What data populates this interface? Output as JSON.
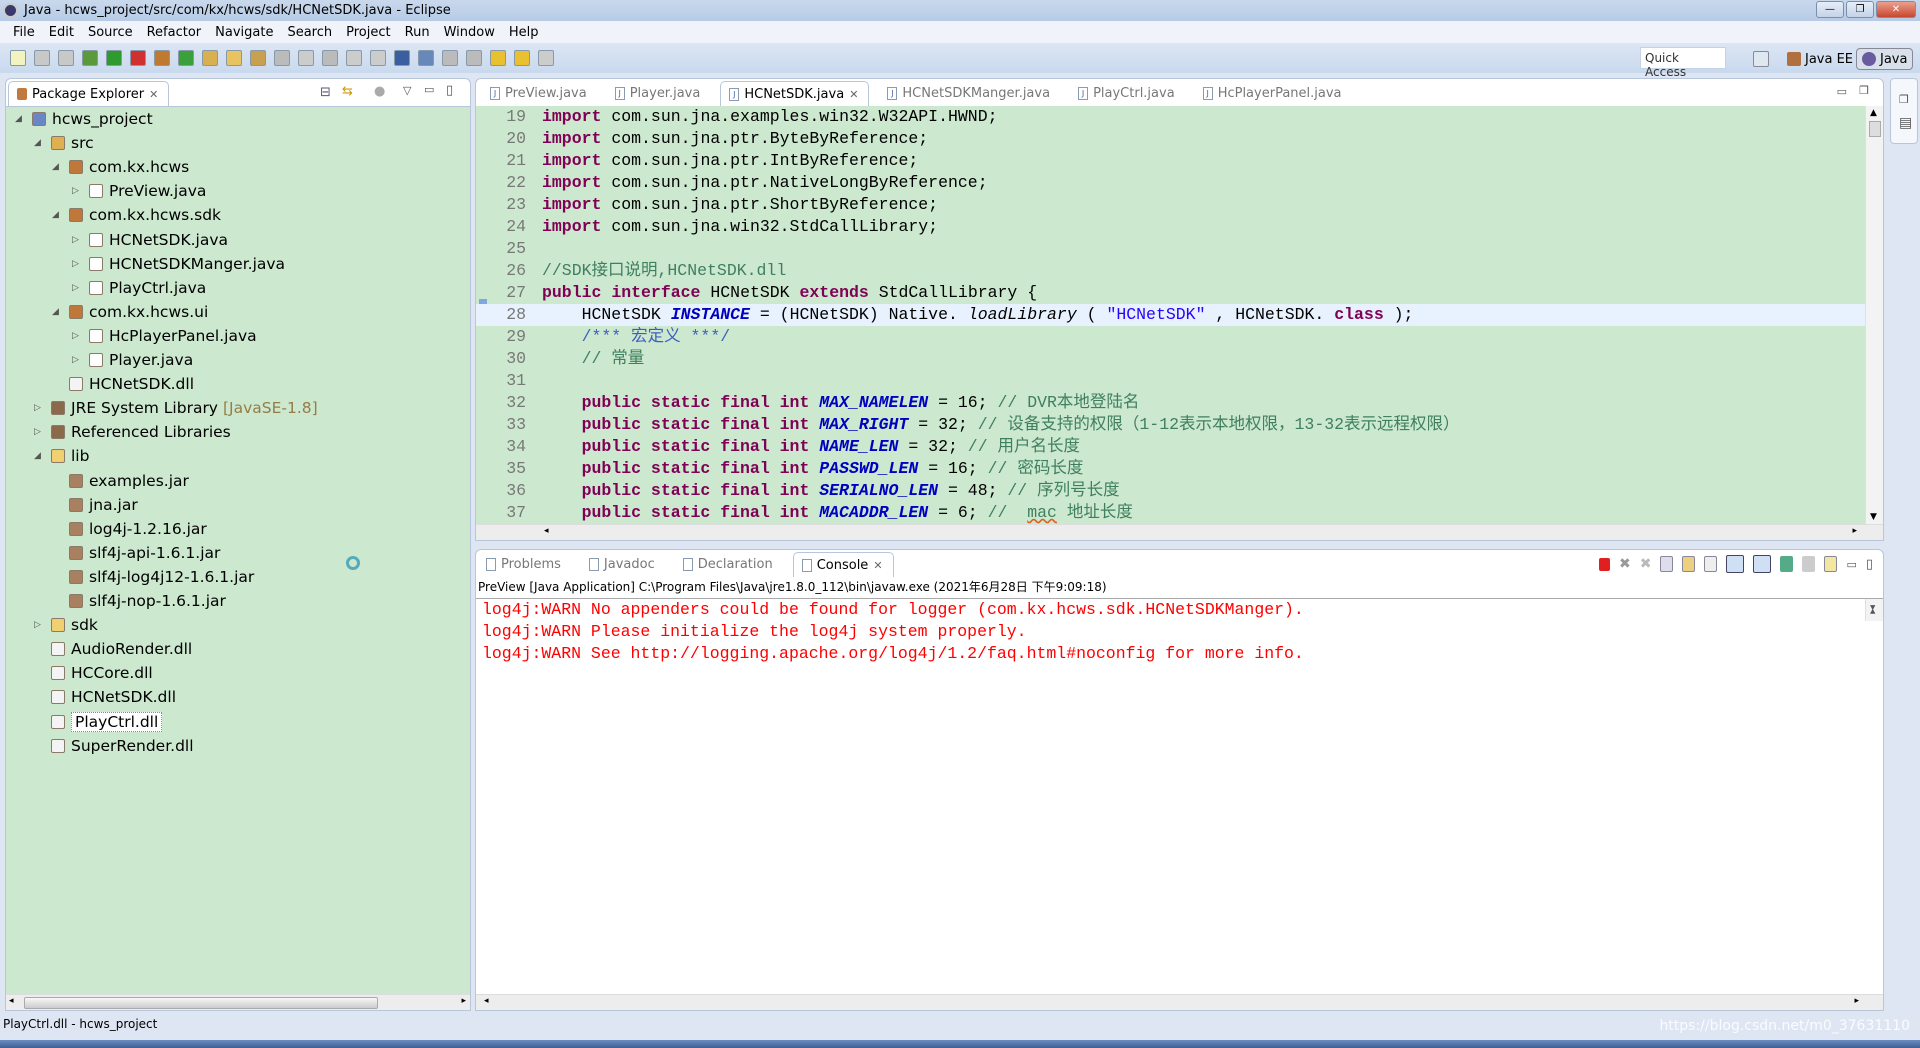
{
  "window": {
    "title": "Java - hcws_project/src/com/kx/hcws/sdk/HCNetSDK.java - Eclipse",
    "controls": [
      "—",
      "❐",
      "✕"
    ]
  },
  "menu": [
    "File",
    "Edit",
    "Source",
    "Refactor",
    "Navigate",
    "Search",
    "Project",
    "Run",
    "Window",
    "Help"
  ],
  "toolbar": {
    "icons": [
      {
        "name": "new-icon",
        "color": "#f3f3c0"
      },
      {
        "name": "save-icon",
        "color": "#c8c8c8"
      },
      {
        "name": "save-all-icon",
        "color": "#c8c8c8"
      },
      {
        "name": "debug-icon",
        "color": "#5a9a3a"
      },
      {
        "name": "run-icon",
        "color": "#2e9b2e"
      },
      {
        "name": "run-external-icon",
        "color": "#d03030"
      },
      {
        "name": "new-package-icon",
        "color": "#c07a30"
      },
      {
        "name": "new-class-icon",
        "color": "#3aa03a"
      },
      {
        "name": "open-type-icon",
        "color": "#d9b050"
      },
      {
        "name": "open-folder-icon",
        "color": "#e8c460"
      },
      {
        "name": "search-icon",
        "color": "#c8a050"
      },
      {
        "name": "pin-icon",
        "color": "#bbbbbb"
      },
      {
        "name": "pen-icon",
        "color": "#cccccc"
      },
      {
        "name": "toggle-icon",
        "color": "#bbbbbb"
      },
      {
        "name": "block-icon",
        "color": "#cccccc"
      },
      {
        "name": "pilcrow-icon",
        "color": "#cccccc"
      },
      {
        "name": "monitor-icon",
        "color": "#3a5fa0"
      },
      {
        "name": "breakpoint-icon",
        "color": "#6688bb"
      },
      {
        "name": "next-annotation-icon",
        "color": "#bbbbbb"
      },
      {
        "name": "prev-annotation-icon",
        "color": "#bbbbbb"
      },
      {
        "name": "last-edit-icon",
        "color": "#e8c030"
      },
      {
        "name": "back-icon",
        "color": "#e8c030"
      },
      {
        "name": "forward-icon",
        "color": "#cccccc"
      }
    ],
    "quick_access": "Quick Access",
    "perspectives": [
      "Java EE",
      "Java"
    ]
  },
  "package_explorer": {
    "title": "Package Explorer",
    "items": [
      {
        "label": "hcws_project",
        "level": 0,
        "expander": "open",
        "icon": "project-icon",
        "color": "#6b86c7"
      },
      {
        "label": "src",
        "level": 1,
        "expander": "open",
        "icon": "source-folder-icon",
        "color": "#e0b050"
      },
      {
        "label": "com.kx.hcws",
        "level": 2,
        "expander": "open",
        "icon": "package-icon",
        "color": "#c0783a"
      },
      {
        "label": "PreView.java",
        "level": 3,
        "expander": "closed",
        "icon": "java-file-icon",
        "color": "#ffffff"
      },
      {
        "label": "com.kx.hcws.sdk",
        "level": 2,
        "expander": "open",
        "icon": "package-icon",
        "color": "#c0783a"
      },
      {
        "label": "HCNetSDK.java",
        "level": 3,
        "expander": "closed",
        "icon": "java-interface-file-icon",
        "color": "#ffffff"
      },
      {
        "label": "HCNetSDKManger.java",
        "level": 3,
        "expander": "closed",
        "icon": "java-file-icon",
        "color": "#ffffff"
      },
      {
        "label": "PlayCtrl.java",
        "level": 3,
        "expander": "closed",
        "icon": "java-interface-file-icon",
        "color": "#ffffff"
      },
      {
        "label": "com.kx.hcws.ui",
        "level": 2,
        "expander": "open",
        "icon": "package-icon",
        "color": "#c0783a"
      },
      {
        "label": "HcPlayerPanel.java",
        "level": 3,
        "expander": "closed",
        "icon": "java-file-icon",
        "color": "#ffffff"
      },
      {
        "label": "Player.java",
        "level": 3,
        "expander": "closed",
        "icon": "java-file-icon",
        "color": "#ffffff"
      },
      {
        "label": "HCNetSDK.dll",
        "level": 2,
        "expander": "none",
        "icon": "file-icon",
        "color": "#f4f4f4"
      },
      {
        "label": "JRE System Library",
        "suffix": "[JavaSE-1.8]",
        "level": 1,
        "expander": "closed",
        "icon": "library-icon",
        "color": "#8a6a4a"
      },
      {
        "label": "Referenced Libraries",
        "level": 1,
        "expander": "closed",
        "icon": "library-icon",
        "color": "#8a6a4a"
      },
      {
        "label": "lib",
        "level": 1,
        "expander": "open",
        "icon": "folder-icon",
        "color": "#f0d070"
      },
      {
        "label": "examples.jar",
        "level": 2,
        "expander": "none",
        "icon": "jar-icon",
        "color": "#a88060"
      },
      {
        "label": "jna.jar",
        "level": 2,
        "expander": "none",
        "icon": "jar-icon",
        "color": "#a88060"
      },
      {
        "label": "log4j-1.2.16.jar",
        "level": 2,
        "expander": "none",
        "icon": "jar-icon",
        "color": "#a88060"
      },
      {
        "label": "slf4j-api-1.6.1.jar",
        "level": 2,
        "expander": "none",
        "icon": "jar-icon",
        "color": "#a88060"
      },
      {
        "label": "slf4j-log4j12-1.6.1.jar",
        "level": 2,
        "expander": "none",
        "icon": "jar-icon",
        "color": "#a88060"
      },
      {
        "label": "slf4j-nop-1.6.1.jar",
        "level": 2,
        "expander": "none",
        "icon": "jar-icon",
        "color": "#a88060"
      },
      {
        "label": "sdk",
        "level": 1,
        "expander": "closed",
        "icon": "folder-icon",
        "color": "#f0d070"
      },
      {
        "label": "AudioRender.dll",
        "level": 1,
        "expander": "none",
        "icon": "file-icon",
        "color": "#f4f4f4"
      },
      {
        "label": "HCCore.dll",
        "level": 1,
        "expander": "none",
        "icon": "file-icon",
        "color": "#f4f4f4"
      },
      {
        "label": "HCNetSDK.dll",
        "level": 1,
        "expander": "none",
        "icon": "file-icon",
        "color": "#f4f4f4"
      },
      {
        "label": "PlayCtrl.dll",
        "level": 1,
        "expander": "none",
        "icon": "file-icon",
        "color": "#f4f4f4",
        "selected": true
      },
      {
        "label": "SuperRender.dll",
        "level": 1,
        "expander": "none",
        "icon": "file-icon",
        "color": "#f4f4f4"
      }
    ]
  },
  "editor": {
    "tabs": [
      {
        "label": "PreView.java"
      },
      {
        "label": "Player.java"
      },
      {
        "label": "HCNetSDK.java",
        "active": true
      },
      {
        "label": "HCNetSDKManger.java"
      },
      {
        "label": "PlayCtrl.java"
      },
      {
        "label": "HcPlayerPanel.java"
      }
    ],
    "current_line": 28,
    "lines": [
      {
        "n": 19,
        "t": [
          [
            "kw",
            "import"
          ],
          [
            "",
            "com.sun.jna.examples.win32.W32API.HWND;"
          ]
        ]
      },
      {
        "n": 20,
        "t": [
          [
            "kw",
            "import"
          ],
          [
            "",
            "com.sun.jna.ptr.ByteByReference;"
          ]
        ]
      },
      {
        "n": 21,
        "t": [
          [
            "kw",
            "import"
          ],
          [
            "",
            "com.sun.jna.ptr.IntByReference;"
          ]
        ]
      },
      {
        "n": 22,
        "t": [
          [
            "kw",
            "import"
          ],
          [
            "",
            "com.sun.jna.ptr.NativeLongByReference;"
          ]
        ]
      },
      {
        "n": 23,
        "t": [
          [
            "kw",
            "import"
          ],
          [
            "",
            "com.sun.jna.ptr.ShortByReference;"
          ]
        ]
      },
      {
        "n": 24,
        "t": [
          [
            "kw",
            "import"
          ],
          [
            "",
            "com.sun.jna.win32.StdCallLibrary;"
          ]
        ]
      },
      {
        "n": 25,
        "t": []
      },
      {
        "n": 26,
        "t": [
          [
            "cm",
            "//SDK接口说明,HCNetSDK.dll"
          ]
        ]
      },
      {
        "n": 27,
        "t": [
          [
            "kw",
            "public"
          ],
          [
            "kw",
            "interface"
          ],
          [
            "",
            "HCNetSDK"
          ],
          [
            "kw",
            "extends"
          ],
          [
            "",
            "StdCallLibrary {"
          ]
        ]
      },
      {
        "n": 28,
        "t": [
          [
            "",
            "    HCNetSDK"
          ],
          [
            "fd",
            "INSTANCE"
          ],
          [
            "",
            "= (HCNetSDK) Native."
          ],
          [
            "it",
            "loadLibrary"
          ],
          [
            "",
            "("
          ],
          [
            "st",
            "\"HCNetSDK\""
          ],
          [
            "",
            ", HCNetSDK."
          ],
          [
            "kw",
            "class"
          ],
          [
            "",
            ");"
          ]
        ]
      },
      {
        "n": 29,
        "t": [
          [
            "jd",
            "    /*** 宏定义 ***/"
          ]
        ]
      },
      {
        "n": 30,
        "t": [
          [
            "cm",
            "    // 常量"
          ]
        ]
      },
      {
        "n": 31,
        "t": []
      },
      {
        "n": 32,
        "t": [
          [
            "kw",
            "    public static final int"
          ],
          [
            "fd",
            "MAX_NAMELEN"
          ],
          [
            "",
            "= 16;"
          ],
          [
            "cm",
            "// DVR本地登陆名"
          ]
        ]
      },
      {
        "n": 33,
        "t": [
          [
            "kw",
            "    public static final int"
          ],
          [
            "fd",
            "MAX_RIGHT"
          ],
          [
            "",
            "= 32;"
          ],
          [
            "cm",
            "// 设备支持的权限（1-12表示本地权限，13-32表示远程权限）"
          ]
        ]
      },
      {
        "n": 34,
        "t": [
          [
            "kw",
            "    public static final int"
          ],
          [
            "fd",
            "NAME_LEN"
          ],
          [
            "",
            "= 32;"
          ],
          [
            "cm",
            "// 用户名长度"
          ]
        ]
      },
      {
        "n": 35,
        "t": [
          [
            "kw",
            "    public static final int"
          ],
          [
            "fd",
            "PASSWD_LEN"
          ],
          [
            "",
            "= 16;"
          ],
          [
            "cm",
            "// 密码长度"
          ]
        ]
      },
      {
        "n": 36,
        "t": [
          [
            "kw",
            "    public static final int"
          ],
          [
            "fd",
            "SERIALNO_LEN"
          ],
          [
            "",
            "= 48;"
          ],
          [
            "cm",
            "// 序列号长度"
          ]
        ]
      },
      {
        "n": 37,
        "t": [
          [
            "kw",
            "    public static final int"
          ],
          [
            "fd",
            "MACADDR_LEN"
          ],
          [
            "",
            "= 6;"
          ],
          [
            "cm",
            "// "
          ],
          [
            "cm sq",
            "mac"
          ],
          [
            "cm",
            "地址长度"
          ]
        ]
      }
    ]
  },
  "console_view": {
    "tabs": [
      {
        "label": "Problems"
      },
      {
        "label": "Javadoc"
      },
      {
        "label": "Declaration"
      },
      {
        "label": "Console",
        "active": true
      }
    ],
    "header": "PreView [Java Application] C:\\Program Files\\Java\\jre1.8.0_112\\bin\\javaw.exe (2021年6月28日 下午9:09:18)",
    "lines": [
      "log4j:WARN No appenders could be found for logger (com.kx.hcws.sdk.HCNetSDKManger).",
      "log4j:WARN Please initialize the log4j system properly.",
      "log4j:WARN See http://logging.apache.org/log4j/1.2/faq.html#noconfig for more info."
    ],
    "text_color": "#ff0000"
  },
  "status": {
    "text": "PlayCtrl.dll - hcws_project",
    "watermark": "https://blog.csdn.net/m0_37631110"
  },
  "colors": {
    "editor_bg": "#cce8cf",
    "keyword": "#7f0055",
    "comment": "#3f7f5f",
    "string": "#2a00ff",
    "field": "#0000c0"
  }
}
